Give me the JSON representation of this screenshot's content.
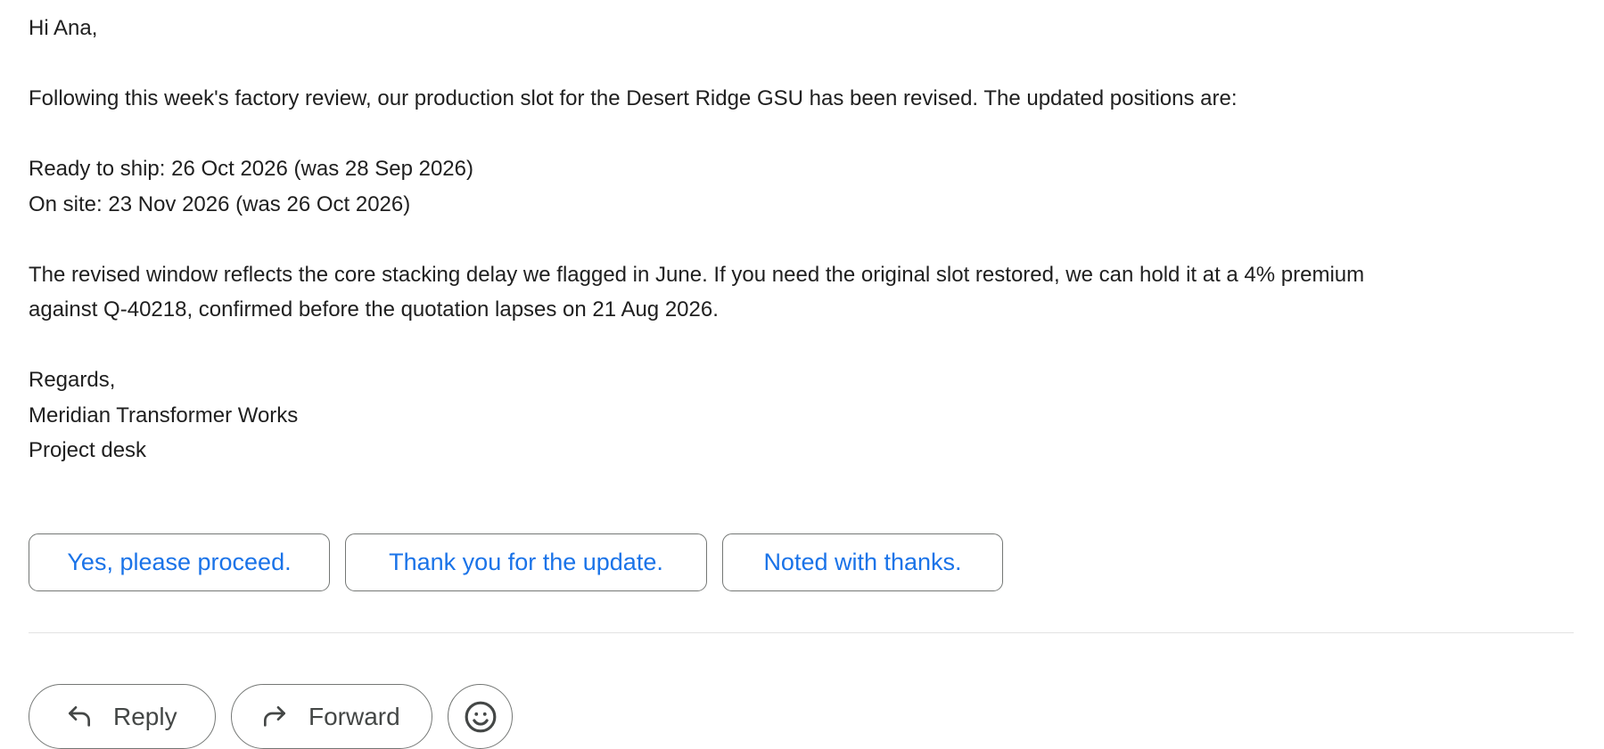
{
  "message": {
    "greeting": "Hi Ana,",
    "intro": "Following this week's factory review, our production slot for the Desert Ridge GSU has been revised. The updated positions are:",
    "ready_to_ship": "Ready to ship: 26 Oct 2026 (was 28 Sep 2026)",
    "on_site": "On site: 23 Nov 2026 (was 26 Oct 2026)",
    "explanation_line1": "The revised window reflects the core stacking delay we flagged in June. If you need the original slot restored, we can hold it at a 4% premium",
    "explanation_line2": "against Q-40218, confirmed before the quotation lapses on 21 Aug 2026.",
    "signoff": "Regards,",
    "company": "Meridian Transformer Works",
    "department": "Project desk"
  },
  "smart_replies": [
    "Yes, please proceed.",
    "Thank you for the update.",
    "Noted with thanks."
  ],
  "actions": {
    "reply_label": "Reply",
    "forward_label": "Forward",
    "reply_icon": "reply-arrow-icon",
    "forward_icon": "forward-arrow-icon",
    "emoji_icon": "smiley-face-icon"
  },
  "colors": {
    "accent": "#1a73e8",
    "text": "#1f1f1f",
    "border": "#747775"
  }
}
